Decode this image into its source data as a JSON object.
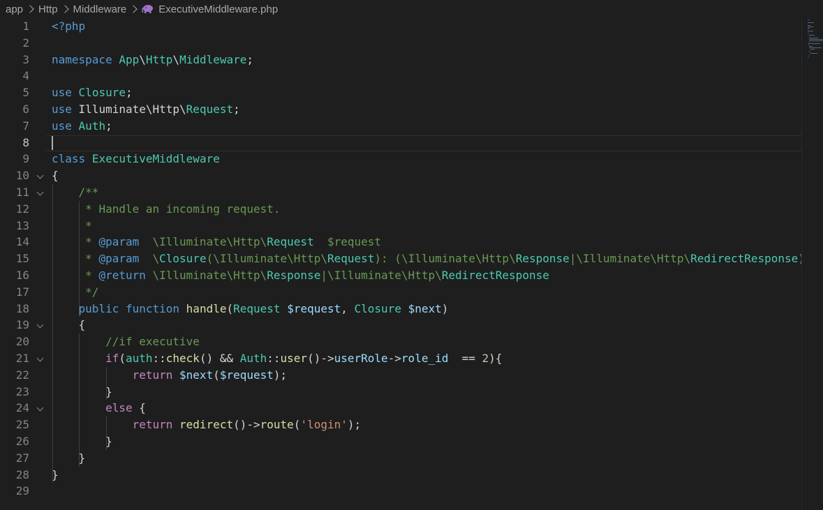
{
  "breadcrumb": {
    "items": [
      "app",
      "Http",
      "Middleware"
    ],
    "file": "ExecutiveMiddleware.php",
    "file_icon": "php-elephant-icon"
  },
  "editor": {
    "language": "php",
    "active_line": 8,
    "lines": [
      {
        "n": "1",
        "tokens": [
          [
            "k",
            "<?php"
          ]
        ]
      },
      {
        "n": "2",
        "tokens": []
      },
      {
        "n": "3",
        "tokens": [
          [
            "k",
            "namespace"
          ],
          [
            "p",
            " "
          ],
          [
            "t",
            "App"
          ],
          [
            "p",
            "\\"
          ],
          [
            "t",
            "Http"
          ],
          [
            "p",
            "\\"
          ],
          [
            "t",
            "Middleware"
          ],
          [
            "p",
            ";"
          ]
        ]
      },
      {
        "n": "4",
        "tokens": []
      },
      {
        "n": "5",
        "tokens": [
          [
            "k",
            "use"
          ],
          [
            "p",
            " "
          ],
          [
            "t",
            "Closure"
          ],
          [
            "p",
            ";"
          ]
        ]
      },
      {
        "n": "6",
        "tokens": [
          [
            "k",
            "use"
          ],
          [
            "p",
            " Illuminate\\Http\\"
          ],
          [
            "t",
            "Request"
          ],
          [
            "p",
            ";"
          ]
        ]
      },
      {
        "n": "7",
        "tokens": [
          [
            "k",
            "use"
          ],
          [
            "p",
            " "
          ],
          [
            "t",
            "Auth"
          ],
          [
            "p",
            ";"
          ]
        ]
      },
      {
        "n": "8",
        "tokens": []
      },
      {
        "n": "9",
        "tokens": [
          [
            "k",
            "class"
          ],
          [
            "p",
            " "
          ],
          [
            "t",
            "ExecutiveMiddleware"
          ]
        ]
      },
      {
        "n": "10",
        "tokens": [
          [
            "p",
            "{"
          ]
        ],
        "fold": true
      },
      {
        "n": "11",
        "tokens": [
          [
            "p",
            "    "
          ],
          [
            "c",
            "/**"
          ]
        ],
        "fold": true
      },
      {
        "n": "12",
        "tokens": [
          [
            "p",
            "     "
          ],
          [
            "c",
            "* Handle an incoming request."
          ]
        ]
      },
      {
        "n": "13",
        "tokens": [
          [
            "p",
            "     "
          ],
          [
            "c",
            "*"
          ]
        ]
      },
      {
        "n": "14",
        "tokens": [
          [
            "p",
            "     "
          ],
          [
            "c",
            "* "
          ],
          [
            "ct",
            "@param"
          ],
          [
            "c",
            "  \\Illuminate\\Http\\"
          ],
          [
            "t",
            "Request"
          ],
          [
            "c",
            "  $request"
          ]
        ]
      },
      {
        "n": "15",
        "tokens": [
          [
            "p",
            "     "
          ],
          [
            "c",
            "* "
          ],
          [
            "ct",
            "@param"
          ],
          [
            "c",
            "  \\"
          ],
          [
            "t",
            "Closure"
          ],
          [
            "c",
            "(\\Illuminate\\Http\\"
          ],
          [
            "t",
            "Request"
          ],
          [
            "c",
            "): (\\Illuminate\\Http\\"
          ],
          [
            "t",
            "Response"
          ],
          [
            "c",
            "|\\Illuminate\\Http\\"
          ],
          [
            "t",
            "RedirectResponse"
          ],
          [
            "c",
            ")"
          ]
        ]
      },
      {
        "n": "16",
        "tokens": [
          [
            "p",
            "     "
          ],
          [
            "c",
            "* "
          ],
          [
            "ct",
            "@return"
          ],
          [
            "c",
            " \\Illuminate\\Http\\"
          ],
          [
            "t",
            "Response"
          ],
          [
            "c",
            "|\\Illuminate\\Http\\"
          ],
          [
            "t",
            "RedirectResponse"
          ]
        ]
      },
      {
        "n": "17",
        "tokens": [
          [
            "p",
            "     "
          ],
          [
            "c",
            "*/"
          ]
        ]
      },
      {
        "n": "18",
        "tokens": [
          [
            "p",
            "    "
          ],
          [
            "k",
            "public"
          ],
          [
            "p",
            " "
          ],
          [
            "k",
            "function"
          ],
          [
            "p",
            " "
          ],
          [
            "f",
            "handle"
          ],
          [
            "p",
            "("
          ],
          [
            "t",
            "Request"
          ],
          [
            "p",
            " "
          ],
          [
            "v",
            "$request"
          ],
          [
            "p",
            ", "
          ],
          [
            "t",
            "Closure"
          ],
          [
            "p",
            " "
          ],
          [
            "v",
            "$next"
          ],
          [
            "p",
            ")"
          ]
        ]
      },
      {
        "n": "19",
        "tokens": [
          [
            "p",
            "    {"
          ]
        ],
        "fold": true
      },
      {
        "n": "20",
        "tokens": [
          [
            "p",
            "        "
          ],
          [
            "c",
            "//if executive"
          ]
        ]
      },
      {
        "n": "21",
        "tokens": [
          [
            "p",
            "        "
          ],
          [
            "kc",
            "if"
          ],
          [
            "p",
            "("
          ],
          [
            "t",
            "auth"
          ],
          [
            "p",
            "::"
          ],
          [
            "f",
            "check"
          ],
          [
            "p",
            "() && "
          ],
          [
            "t",
            "Auth"
          ],
          [
            "p",
            "::"
          ],
          [
            "f",
            "user"
          ],
          [
            "p",
            "()->"
          ],
          [
            "v",
            "userRole"
          ],
          [
            "p",
            "->"
          ],
          [
            "v",
            "role_id"
          ],
          [
            "p",
            "  == "
          ],
          [
            "n",
            "2"
          ],
          [
            "p",
            "){"
          ]
        ],
        "fold": true
      },
      {
        "n": "22",
        "tokens": [
          [
            "p",
            "            "
          ],
          [
            "kc",
            "return"
          ],
          [
            "p",
            " "
          ],
          [
            "v",
            "$next"
          ],
          [
            "p",
            "("
          ],
          [
            "v",
            "$request"
          ],
          [
            "p",
            ");"
          ]
        ]
      },
      {
        "n": "23",
        "tokens": [
          [
            "p",
            "        }"
          ]
        ]
      },
      {
        "n": "24",
        "tokens": [
          [
            "p",
            "        "
          ],
          [
            "kc",
            "else"
          ],
          [
            "p",
            " {"
          ]
        ],
        "fold": true
      },
      {
        "n": "25",
        "tokens": [
          [
            "p",
            "            "
          ],
          [
            "kc",
            "return"
          ],
          [
            "p",
            " "
          ],
          [
            "f",
            "redirect"
          ],
          [
            "p",
            "()->"
          ],
          [
            "f",
            "route"
          ],
          [
            "p",
            "("
          ],
          [
            "s",
            "'login'"
          ],
          [
            "p",
            ");"
          ]
        ]
      },
      {
        "n": "26",
        "tokens": [
          [
            "p",
            "        }"
          ]
        ]
      },
      {
        "n": "27",
        "tokens": [
          [
            "p",
            "    }"
          ]
        ]
      },
      {
        "n": "28",
        "tokens": [
          [
            "p",
            "}"
          ]
        ]
      },
      {
        "n": "29",
        "tokens": []
      }
    ]
  },
  "colors": {
    "background": "#1e1e1e",
    "keyword": "#569cd6",
    "control": "#c586c0",
    "type": "#4ec9b0",
    "function": "#dcdcaa",
    "variable": "#9cdcfe",
    "comment": "#6a9955",
    "string": "#ce9178",
    "number": "#b5cea8"
  }
}
